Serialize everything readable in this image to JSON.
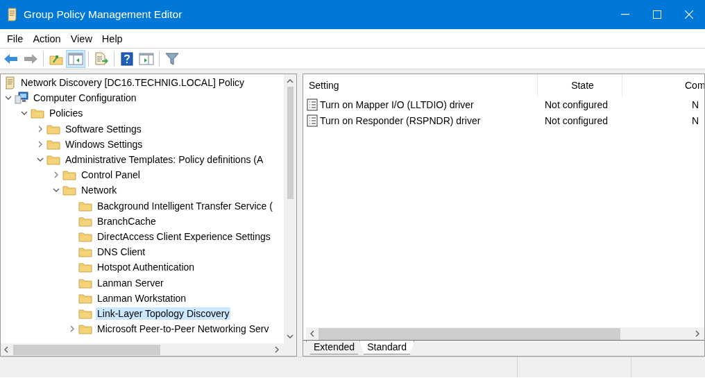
{
  "window": {
    "title": "Group Policy Management Editor"
  },
  "menu": [
    "File",
    "Action",
    "View",
    "Help"
  ],
  "toolbar": [
    {
      "kind": "back",
      "disabled": false,
      "pressed": false
    },
    {
      "kind": "forward",
      "disabled": true,
      "pressed": false
    },
    {
      "kind": "sep"
    },
    {
      "kind": "up",
      "disabled": false,
      "pressed": false
    },
    {
      "kind": "tree",
      "disabled": false,
      "pressed": true
    },
    {
      "kind": "sep"
    },
    {
      "kind": "export",
      "disabled": false,
      "pressed": false
    },
    {
      "kind": "sep"
    },
    {
      "kind": "help",
      "disabled": false,
      "pressed": false
    },
    {
      "kind": "pane",
      "disabled": false,
      "pressed": false
    },
    {
      "kind": "sep"
    },
    {
      "kind": "filter",
      "disabled": false,
      "pressed": false
    }
  ],
  "tree": {
    "root": "Network Discovery  [DC16.TECHNIG.LOCAL] Policy",
    "items": [
      {
        "label": "Computer Configuration",
        "kind": "computer",
        "expanded": true,
        "selected": false,
        "children": [
          {
            "label": "Policies",
            "kind": "folder",
            "expanded": true,
            "selected": false,
            "children": [
              {
                "label": "Software Settings",
                "kind": "folder",
                "expanded": false,
                "selected": false
              },
              {
                "label": "Windows Settings",
                "kind": "folder",
                "expanded": false,
                "selected": false
              },
              {
                "label": "Administrative Templates: Policy definitions (A",
                "kind": "folder",
                "expanded": true,
                "selected": false,
                "children": [
                  {
                    "label": "Control Panel",
                    "kind": "folder",
                    "expanded": false,
                    "selected": false
                  },
                  {
                    "label": "Network",
                    "kind": "folder",
                    "expanded": true,
                    "selected": false,
                    "children": [
                      {
                        "label": "Background Intelligent Transfer Service (",
                        "kind": "folder",
                        "selected": false
                      },
                      {
                        "label": "BranchCache",
                        "kind": "folder",
                        "selected": false
                      },
                      {
                        "label": "DirectAccess Client Experience Settings",
                        "kind": "folder",
                        "selected": false
                      },
                      {
                        "label": "DNS Client",
                        "kind": "folder",
                        "selected": false
                      },
                      {
                        "label": "Hotspot Authentication",
                        "kind": "folder",
                        "selected": false
                      },
                      {
                        "label": "Lanman Server",
                        "kind": "folder",
                        "selected": false
                      },
                      {
                        "label": "Lanman Workstation",
                        "kind": "folder",
                        "selected": false
                      },
                      {
                        "label": "Link-Layer Topology Discovery",
                        "kind": "folder",
                        "selected": true
                      },
                      {
                        "label": "Microsoft Peer-to-Peer Networking Serv",
                        "kind": "folder",
                        "expanded": false,
                        "selected": false
                      }
                    ]
                  }
                ]
              }
            ]
          }
        ]
      }
    ]
  },
  "settings": {
    "columns": [
      "Setting",
      "State",
      "Com"
    ],
    "rows": [
      {
        "setting": "Turn on Mapper I/O (LLTDIO) driver",
        "state": "Not configured",
        "column_3": "N"
      },
      {
        "setting": "Turn on Responder (RSPNDR) driver",
        "state": "Not configured",
        "column_3": "N"
      }
    ]
  },
  "view_tabs": [
    {
      "label": "Extended",
      "selected": false
    },
    {
      "label": "Standard",
      "selected": true
    }
  ]
}
